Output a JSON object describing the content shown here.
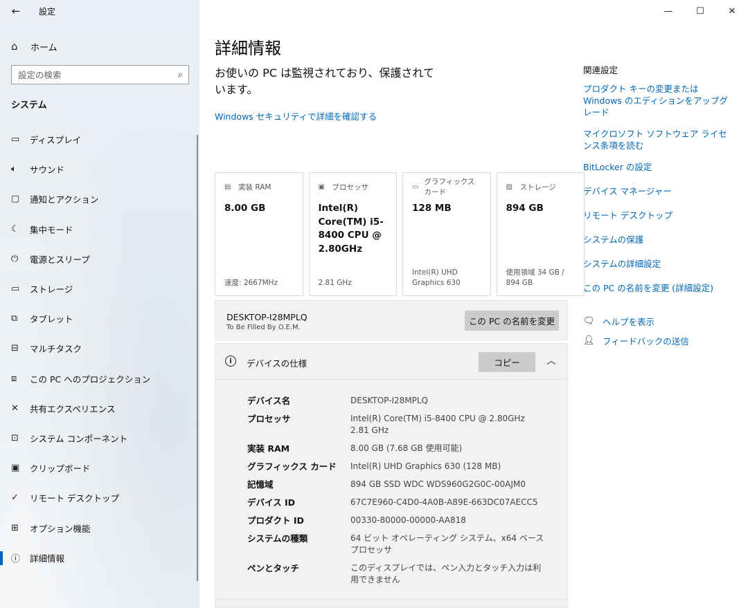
{
  "window": {
    "title": "設定",
    "back_glyph": "←",
    "controls": {
      "minimize": "—",
      "maximize": "☐",
      "close": "✕"
    }
  },
  "sidebar": {
    "home_label": "ホーム",
    "search_placeholder": "設定の検索",
    "section_title": "システム",
    "items": [
      {
        "label": "ディスプレイ",
        "icon": "monitor-icon",
        "glyph": "▭"
      },
      {
        "label": "サウンド",
        "icon": "speaker-icon",
        "glyph": "🔈︎"
      },
      {
        "label": "通知とアクション",
        "icon": "message-icon",
        "glyph": "▢"
      },
      {
        "label": "集中モード",
        "icon": "moon-icon",
        "glyph": "☾"
      },
      {
        "label": "電源とスリープ",
        "icon": "power-icon",
        "glyph": "⏻"
      },
      {
        "label": "ストレージ",
        "icon": "storage-icon",
        "glyph": "▭"
      },
      {
        "label": "タブレット",
        "icon": "tablet-icon",
        "glyph": "⧉"
      },
      {
        "label": "マルチタスク",
        "icon": "multitask-icon",
        "glyph": "⊟"
      },
      {
        "label": "この PC へのプロジェクション",
        "icon": "projection-icon",
        "glyph": "⧈"
      },
      {
        "label": "共有エクスペリエンス",
        "icon": "share-icon",
        "glyph": "✕"
      },
      {
        "label": "システム コンポーネント",
        "icon": "components-icon",
        "glyph": "⊡"
      },
      {
        "label": "クリップボード",
        "icon": "clipboard-icon",
        "glyph": "▣"
      },
      {
        "label": "リモート デスクトップ",
        "icon": "remote-icon",
        "glyph": "✓"
      },
      {
        "label": "オプション機能",
        "icon": "features-icon",
        "glyph": "⊞"
      },
      {
        "label": "詳細情報",
        "icon": "info-icon",
        "glyph": "ⓘ"
      }
    ],
    "active_index": 14
  },
  "main": {
    "title": "詳細情報",
    "protect_message": "お使いの PC は監視されており、保護されています。",
    "security_link": "Windows セキュリティで詳細を確認する",
    "cards": [
      {
        "header": "実装 RAM",
        "icon": "ram-icon",
        "glyph": "▤",
        "value": "8.00 GB",
        "sub": "速度: 2667MHz"
      },
      {
        "header": "プロセッサ",
        "icon": "cpu-icon",
        "glyph": "▣",
        "value": "Intel(R) Core(TM) i5-8400 CPU @ 2.80GHz",
        "sub": "2.81 GHz"
      },
      {
        "header": "グラフィックス カード",
        "icon": "gpu-icon",
        "glyph": "▭",
        "value": "128 MB",
        "sub": "Intel(R) UHD Graphics 630"
      },
      {
        "header": "ストレージ",
        "icon": "disk-icon",
        "glyph": "▨",
        "value": "894 GB",
        "sub": "使用領域 34 GB / 894 GB"
      }
    ],
    "pc_name": "DESKTOP-I28MPLQ",
    "oem": "To Be Filled By O.E.M.",
    "rename_button": "この PC の名前を変更",
    "device_spec": {
      "title": "デバイスの仕様",
      "copy_button": "コピー",
      "rows": [
        {
          "key": "デバイス名",
          "value": "DESKTOP-I28MPLQ"
        },
        {
          "key": "プロセッサ",
          "value": "Intel(R) Core(TM) i5-8400 CPU @ 2.80GHz   2.81 GHz"
        },
        {
          "key": "実装 RAM",
          "value": "8.00 GB (7.68 GB 使用可能)"
        },
        {
          "key": "グラフィックス カード",
          "value": "Intel(R) UHD Graphics 630 (128 MB)"
        },
        {
          "key": "記憶域",
          "value": "894 GB SSD WDC WDS960G2G0C-00AJM0"
        },
        {
          "key": "デバイス ID",
          "value": "67C7E960-C4D0-4A0B-A89E-663DC07AECC5"
        },
        {
          "key": "プロダクト ID",
          "value": "00330-80000-00000-AA818"
        },
        {
          "key": "システムの種類",
          "value": "64 ビット オペレーティング システム、x64 ベース プロセッサ"
        },
        {
          "key": "ペンとタッチ",
          "value": "このディスプレイでは、ペン入力とタッチ入力は利用できません"
        }
      ]
    }
  },
  "related": {
    "title": "関連設定",
    "links": [
      "プロダクト キーの変更または Windows のエディションをアップグレード",
      "マイクロソフト ソフトウェア ライセンス条項を読む",
      "BitLocker の設定",
      "デバイス マネージャー",
      "リモート デスクトップ",
      "システムの保護",
      "システムの詳細設定",
      "この PC の名前を変更 (詳細設定)"
    ],
    "help_label": "ヘルプを表示",
    "feedback_label": "フィードバックの送信"
  }
}
